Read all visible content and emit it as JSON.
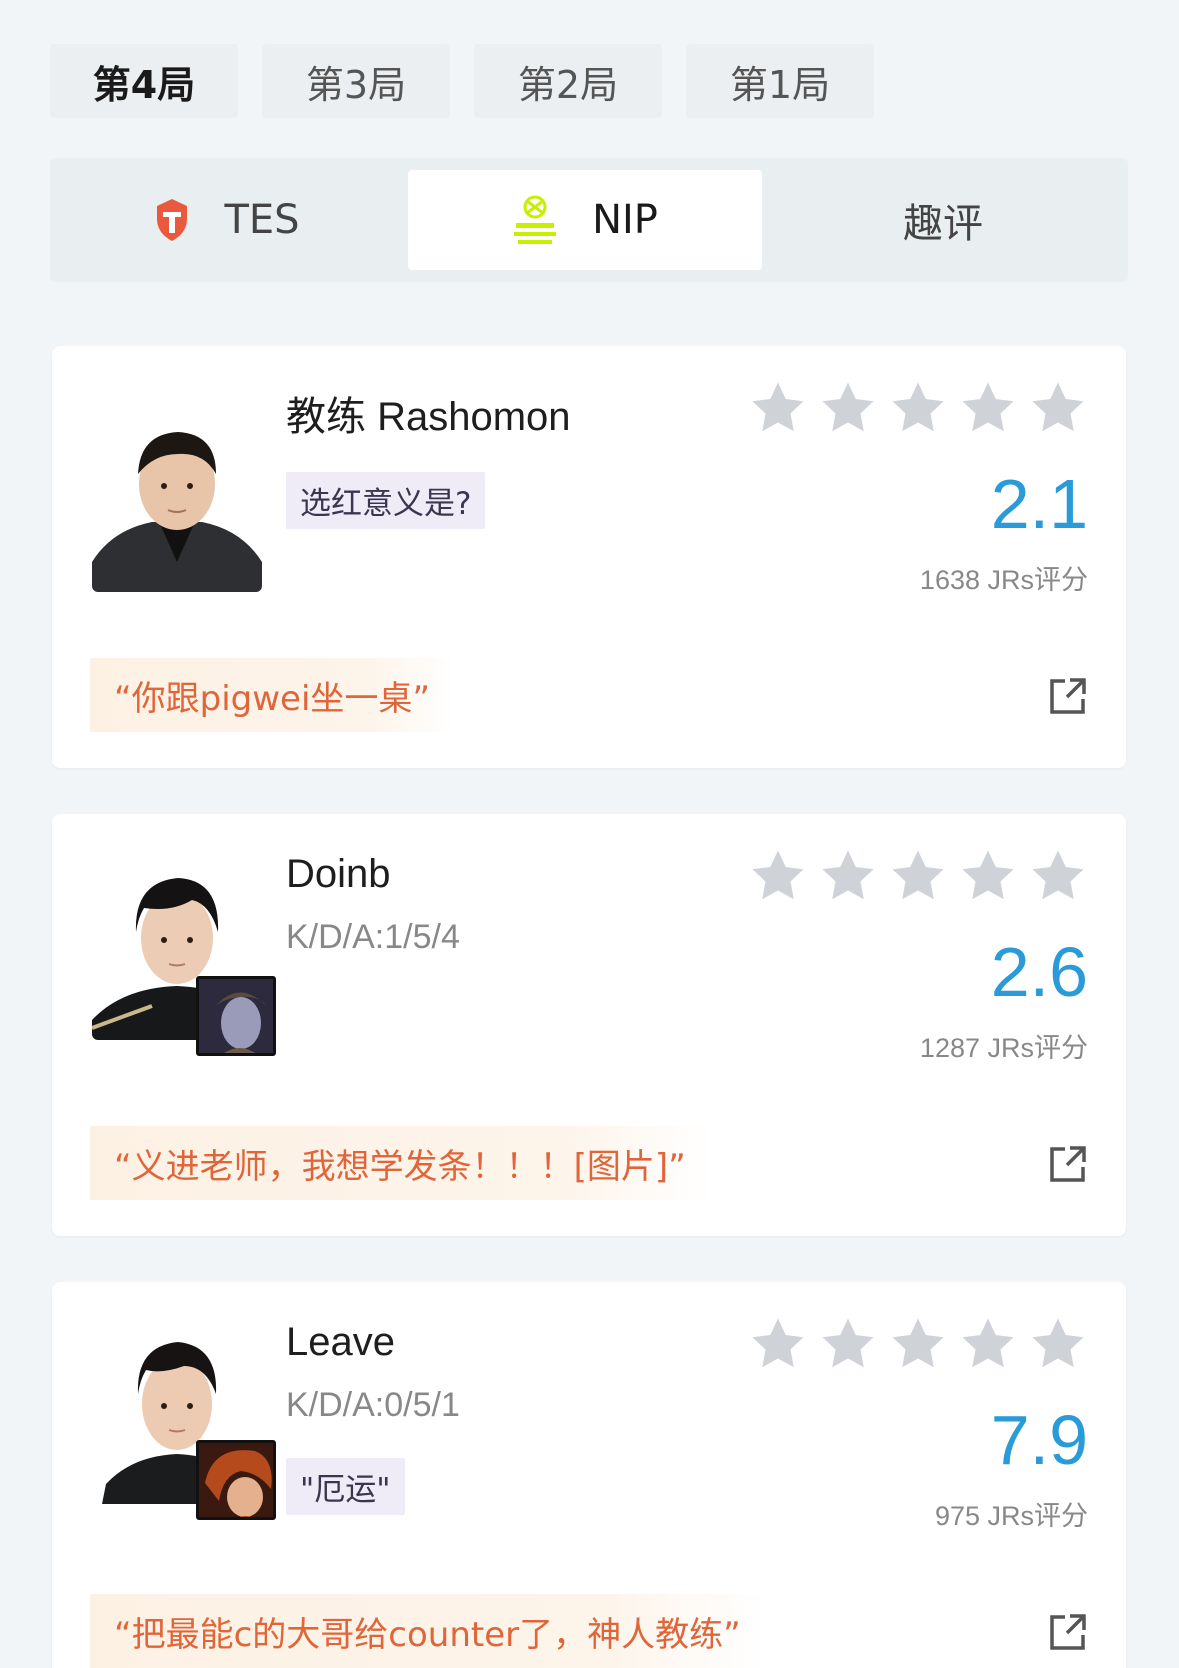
{
  "game_tabs": [
    "第4局",
    "第3局",
    "第2局",
    "第1局"
  ],
  "active_game_index": 0,
  "team_tabs": {
    "tes": "TES",
    "nip": "NIP",
    "comment": "趣评"
  },
  "active_team": "NIP",
  "colors": {
    "accent_score": "#2a9bd8",
    "quote_text": "#e0663a",
    "star": "#cfd3d8",
    "tes_logo": "#e8593e",
    "nip_logo": "#c6f000"
  },
  "players": [
    {
      "name": "教练 Rashomon",
      "kda": "",
      "tag": "选红意义是?",
      "rating": "2.1",
      "votes": "1638 JRs评分",
      "quote": "“你跟pigwei坐一桌”",
      "stars_filled": 0
    },
    {
      "name": "Doinb",
      "kda": "K/D/A:1/5/4",
      "tag": "",
      "rating": "2.6",
      "votes": "1287 JRs评分",
      "quote": "“义进老师，我想学发条！！！[图片]”",
      "stars_filled": 0
    },
    {
      "name": "Leave",
      "kda": "K/D/A:0/5/1",
      "tag": "\"厄运\"",
      "rating": "7.9",
      "votes": "975 JRs评分",
      "quote": "“把最能c的大哥给counter了，神人教练”",
      "stars_filled": 0
    }
  ]
}
